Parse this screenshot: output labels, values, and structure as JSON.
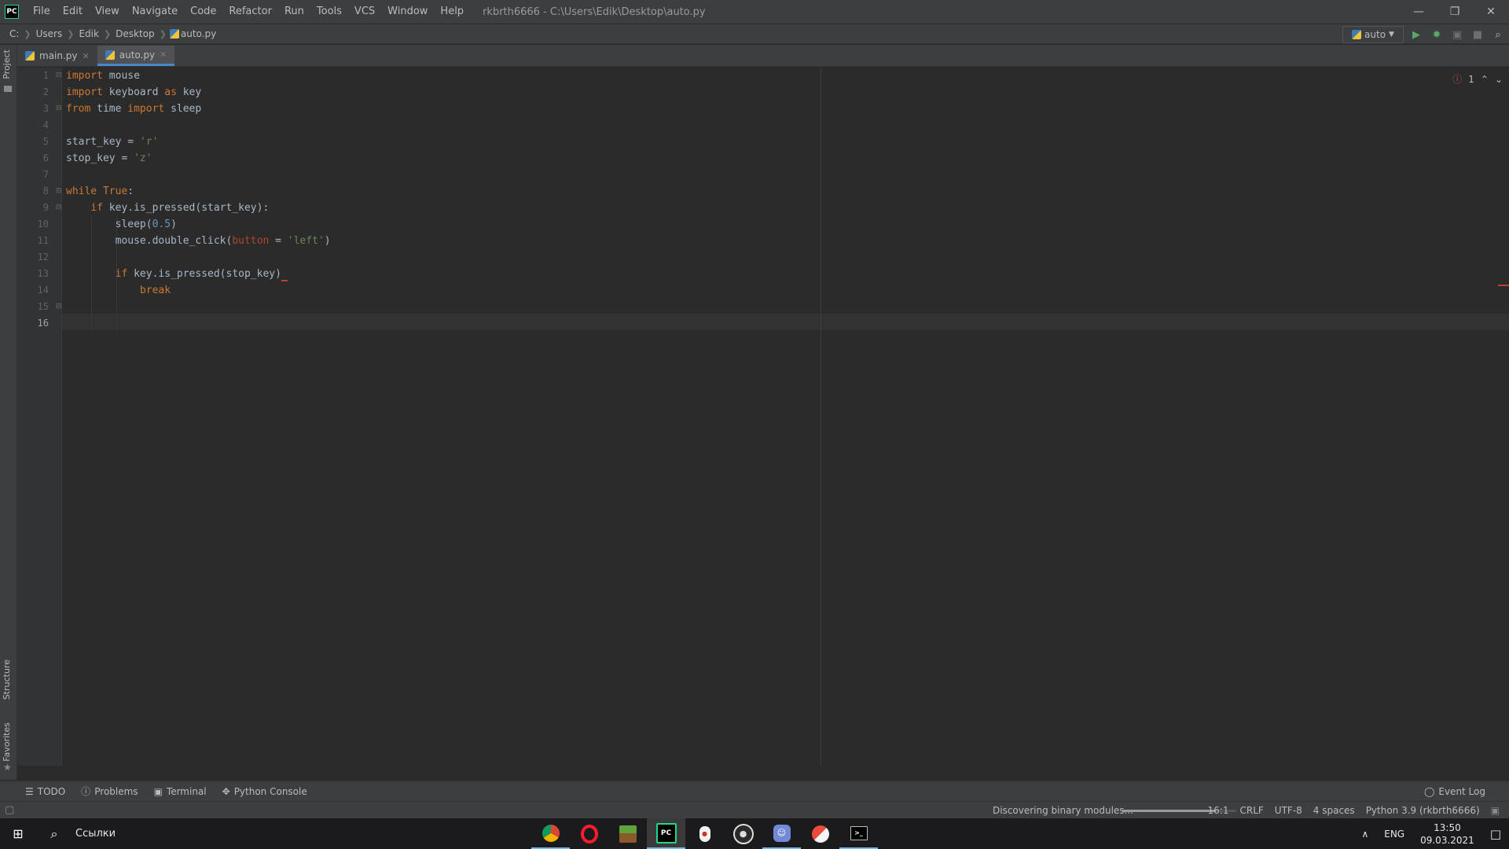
{
  "titlebar": {
    "app_logo": "PC",
    "menu": [
      "File",
      "Edit",
      "View",
      "Navigate",
      "Code",
      "Refactor",
      "Run",
      "Tools",
      "VCS",
      "Window",
      "Help"
    ],
    "window_title": "rkbrth6666 - C:\\Users\\Edik\\Desktop\\auto.py"
  },
  "navbar": {
    "crumbs": [
      "C:",
      "Users",
      "Edik",
      "Desktop",
      "auto.py"
    ],
    "run_config": "auto"
  },
  "tabs": [
    {
      "label": "main.py",
      "active": false
    },
    {
      "label": "auto.py",
      "active": true
    }
  ],
  "left_strip": {
    "project": "Project",
    "structure": "Structure",
    "favorites": "Favorites"
  },
  "editor": {
    "error_count": "1",
    "current_line": 16,
    "line_numbers": [
      "1",
      "2",
      "3",
      "4",
      "5",
      "6",
      "7",
      "8",
      "9",
      "10",
      "11",
      "12",
      "13",
      "14",
      "15",
      "16"
    ]
  },
  "bottom_tools": [
    "TODO",
    "Problems",
    "Terminal",
    "Python Console"
  ],
  "event_log": "Event Log",
  "status": {
    "message": "Discovering binary modules...",
    "progress": 0.82,
    "position": "16:1",
    "line_sep": "CRLF",
    "encoding": "UTF-8",
    "indent": "4 spaces",
    "interpreter": "Python 3.9 (rkbrth6666)"
  },
  "taskbar": {
    "search_label": "Ссылки",
    "lang": "ENG",
    "time": "13:50",
    "date": "09.03.2021"
  },
  "colors": {
    "keyword": "#cc7832",
    "string": "#6a8759",
    "number": "#6897bb",
    "param": "#aa4926",
    "accent": "#4a88c7"
  }
}
